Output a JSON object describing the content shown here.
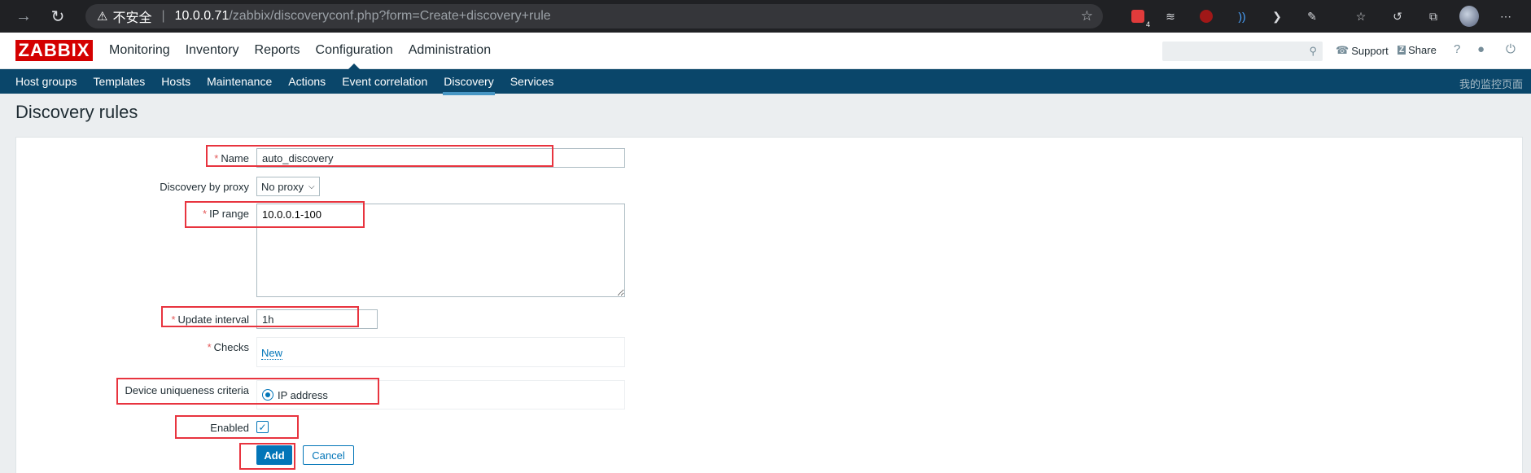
{
  "browser": {
    "insecure_label": "不安全",
    "url_host": "10.0.0.71",
    "url_path": "/zabbix/discoveryconf.php?form=Create+discovery+rule",
    "extension_badge": "4"
  },
  "header": {
    "logo": "ZABBIX",
    "menu": [
      "Monitoring",
      "Inventory",
      "Reports",
      "Configuration",
      "Administration"
    ],
    "support": "Support",
    "share": "Share",
    "help": "?"
  },
  "subnav": {
    "items": [
      "Host groups",
      "Templates",
      "Hosts",
      "Maintenance",
      "Actions",
      "Event correlation",
      "Discovery",
      "Services"
    ],
    "right_text": "我的监控页面"
  },
  "page": {
    "title": "Discovery rules"
  },
  "form": {
    "name_label": "Name",
    "name_value": "auto_discovery",
    "proxy_label": "Discovery by proxy",
    "proxy_value": "No proxy",
    "ip_range_label": "IP range",
    "ip_range_value": "10.0.0.1-100",
    "interval_label": "Update interval",
    "interval_value": "1h",
    "checks_label": "Checks",
    "checks_new": "New",
    "uniqueness_label": "Device uniqueness criteria",
    "uniqueness_option": "IP address",
    "enabled_label": "Enabled",
    "required_mark": "*",
    "add_button": "Add",
    "cancel_button": "Cancel"
  },
  "colors": {
    "accent": "#0275b8",
    "nav_bg": "#0a466a",
    "highlight": "#e8343f",
    "logo": "#d40000"
  }
}
